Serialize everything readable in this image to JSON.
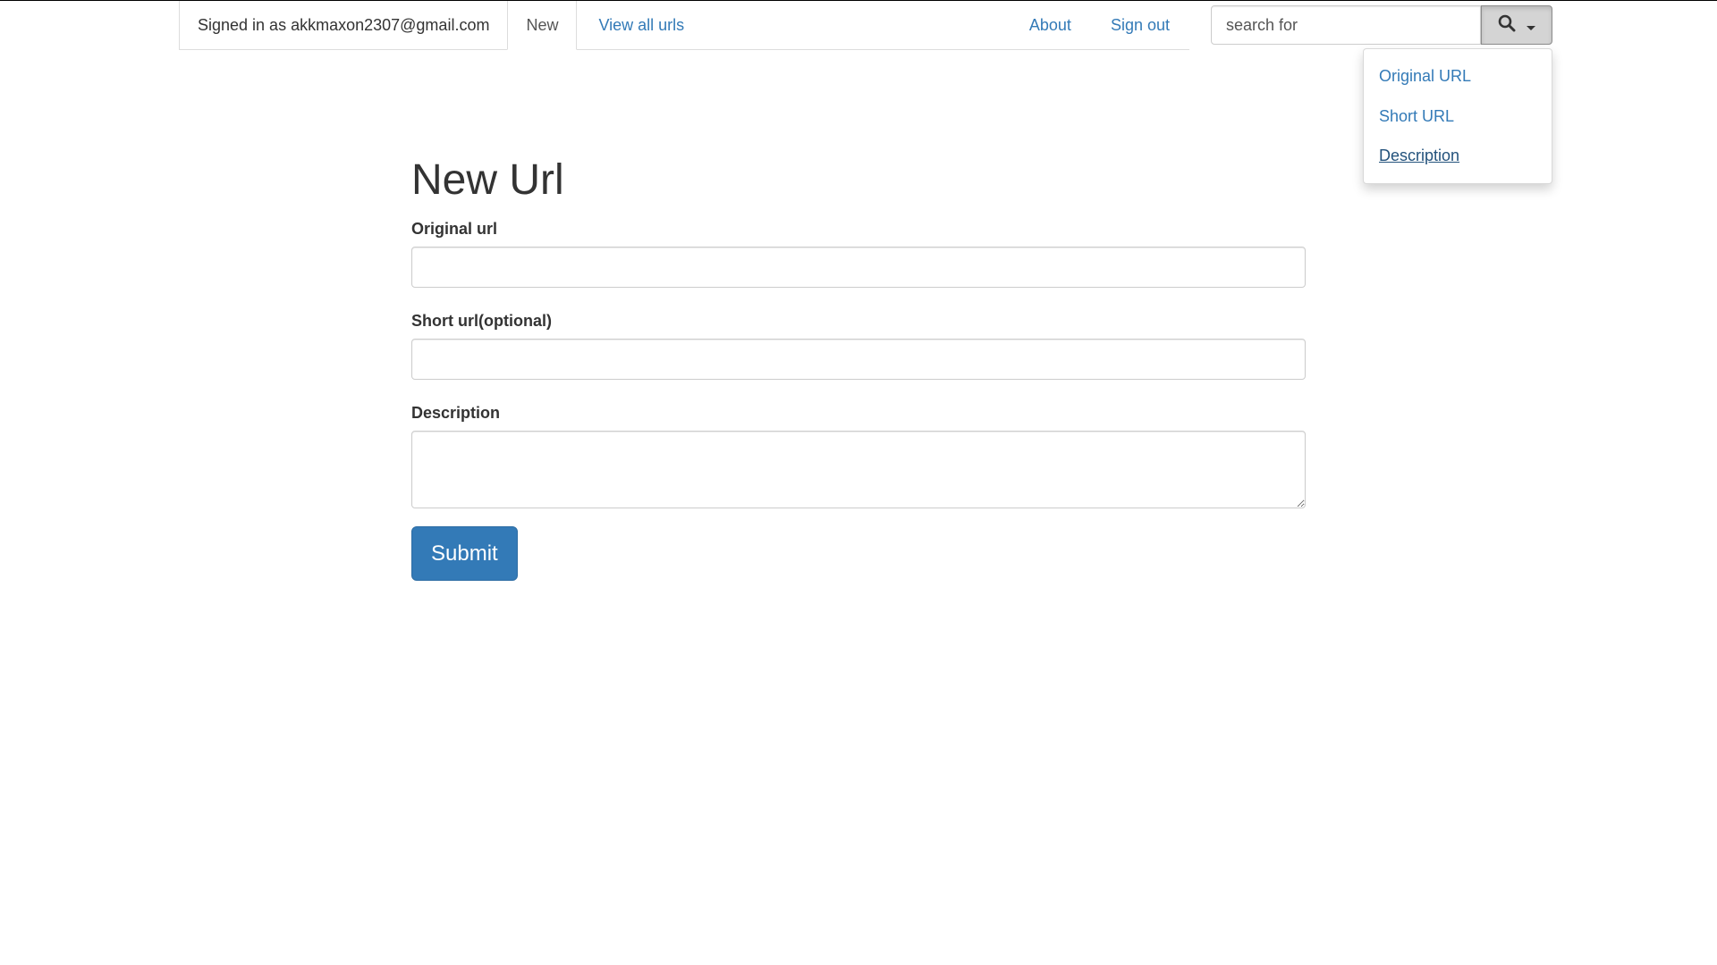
{
  "navbar": {
    "signed_in_text": "Signed in as akkmaxon2307@gmail.com",
    "tabs": [
      {
        "label": "New",
        "active": true
      },
      {
        "label": "View all urls",
        "active": false
      }
    ],
    "right_links": [
      {
        "label": "About"
      },
      {
        "label": "Sign out"
      }
    ]
  },
  "search": {
    "placeholder": "search for",
    "button_icon": "search-icon",
    "dropdown_icon": "caret-down-icon",
    "dropdown_items": [
      {
        "label": "Original URL"
      },
      {
        "label": "Short URL"
      },
      {
        "label": "Description",
        "hovered": true
      }
    ]
  },
  "form": {
    "title": "New Url",
    "fields": [
      {
        "label": "Original url",
        "value": ""
      },
      {
        "label": "Short url(optional)",
        "value": ""
      },
      {
        "label": "Description",
        "value": ""
      }
    ],
    "submit_label": "Submit"
  },
  "colors": {
    "link": "#337ab7",
    "primary_button": "#337ab7",
    "text": "#333333",
    "border": "#cccccc"
  }
}
